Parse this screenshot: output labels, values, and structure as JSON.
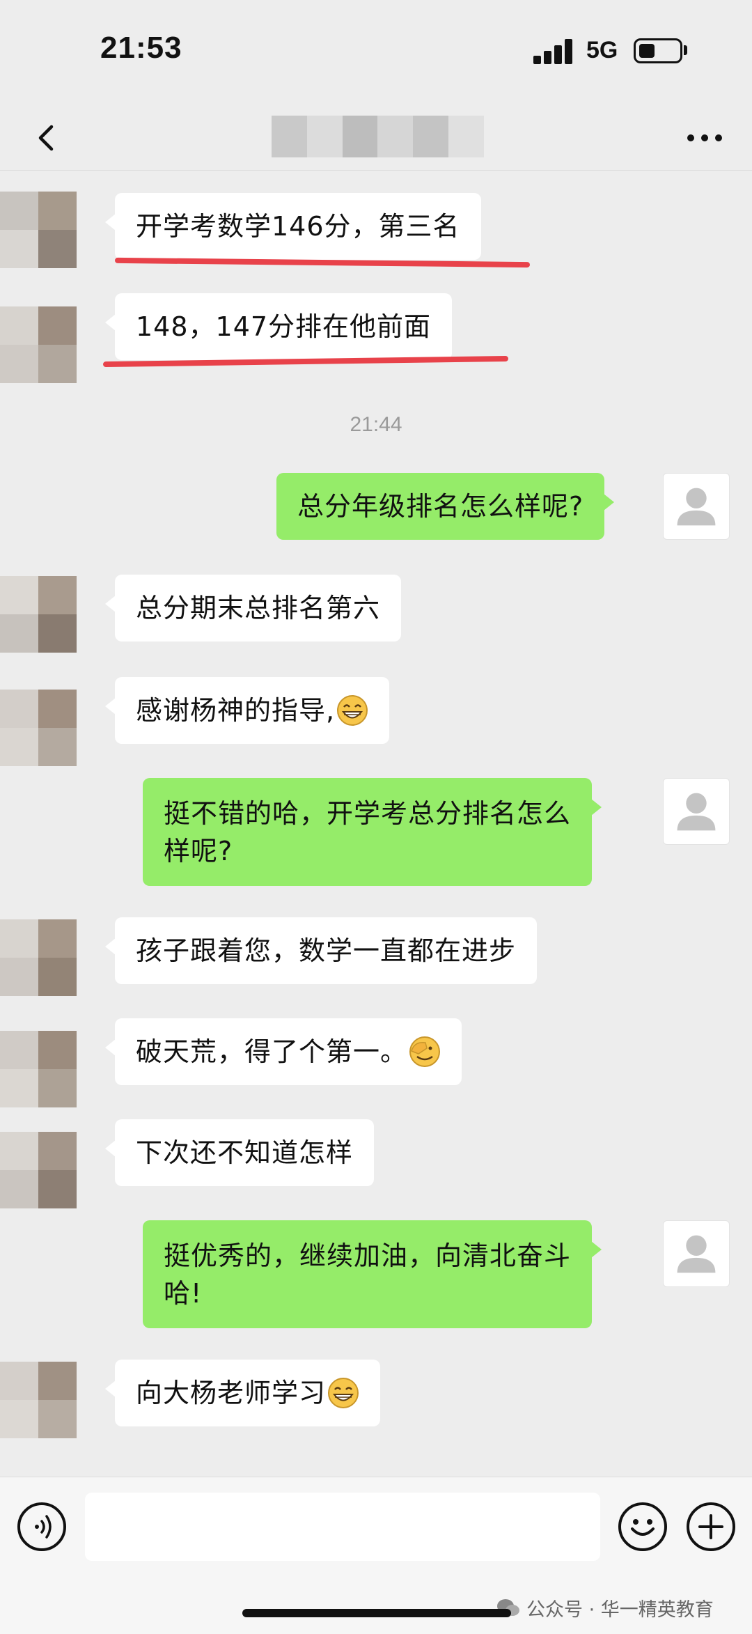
{
  "status_bar": {
    "time": "21:53",
    "network": "5G"
  },
  "conversation": {
    "timestamp": "21:44",
    "messages": [
      {
        "side": "in",
        "text": "开学考数学146分，第三名"
      },
      {
        "side": "in",
        "text": "148，147分排在他前面"
      },
      {
        "side": "out",
        "text": "总分年级排名怎么样呢?"
      },
      {
        "side": "in",
        "text": "总分期末总排名第六"
      },
      {
        "side": "in",
        "text": "感谢杨神的指导,"
      },
      {
        "side": "out",
        "text_line1": "挺不错的哈，开学考总分排名怎么",
        "text_line2": "样呢?"
      },
      {
        "side": "in",
        "text": "孩子跟着您，数学一直都在进步"
      },
      {
        "side": "in",
        "text": "破天荒，得了个第一。"
      },
      {
        "side": "in",
        "text": "下次还不知道怎样"
      },
      {
        "side": "out",
        "text_line1": "挺优秀的，继续加油，向清北奋斗",
        "text_line2": "哈!"
      },
      {
        "side": "in",
        "text": "向大杨老师学习"
      }
    ]
  },
  "watermark": {
    "text": "公众号 · 华一精英教育"
  },
  "colors": {
    "background": "#ededed",
    "incoming_bubble": "#ffffff",
    "outgoing_bubble": "#95ec69",
    "underline": "#e8424a"
  },
  "icons": [
    "back-arrow",
    "more-dots",
    "voice",
    "emoji-smile",
    "plus",
    "grin-emoji",
    "facepalm-emoji",
    "default-avatar"
  ]
}
